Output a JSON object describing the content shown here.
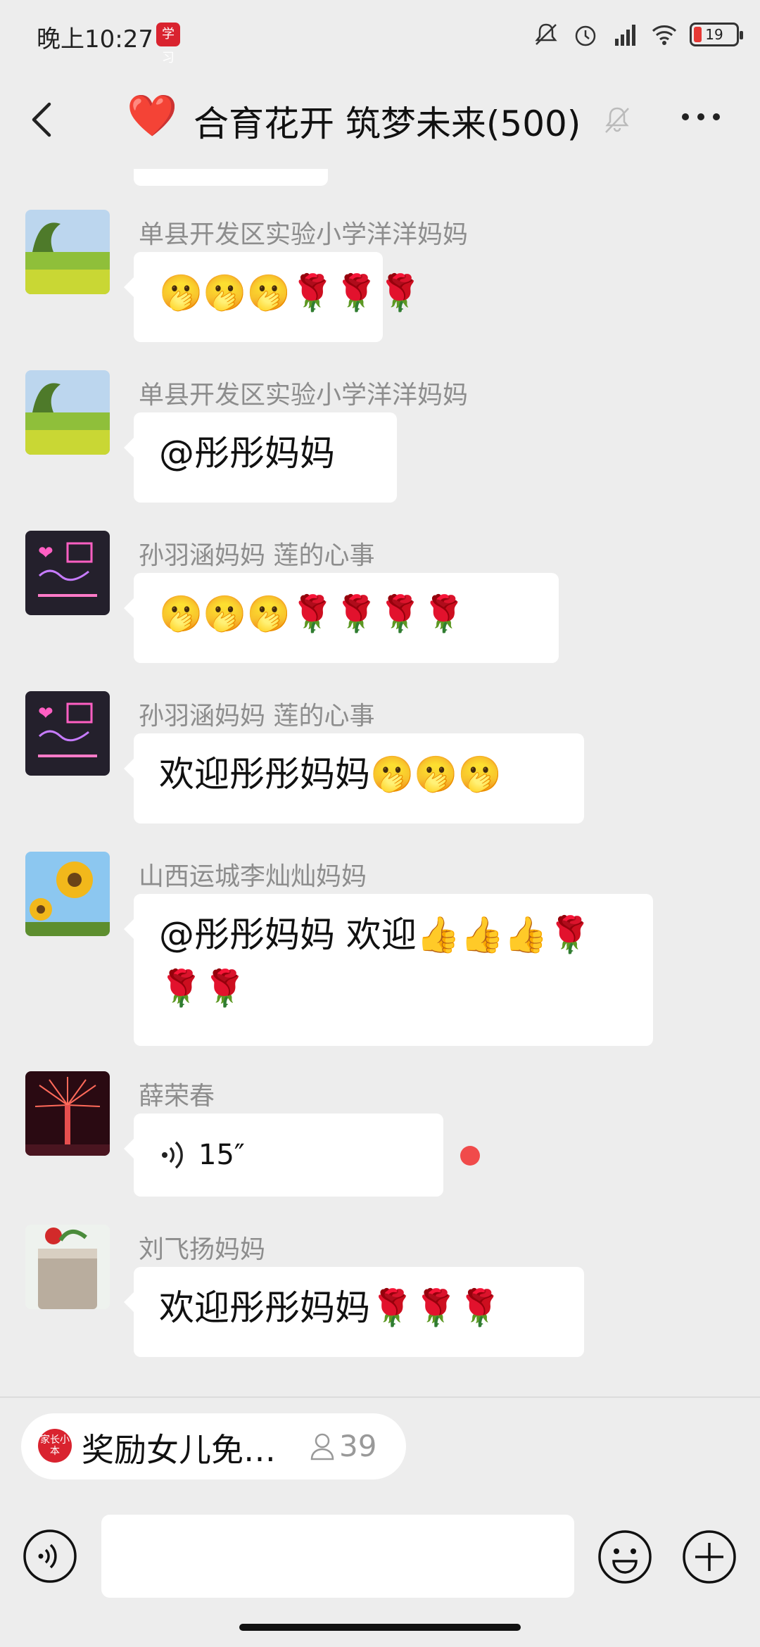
{
  "status_bar": {
    "time": "晚上10:27",
    "app_badge": "学习",
    "battery": "19"
  },
  "header": {
    "title": "合育花开 筑梦未来(500)",
    "heart": "❤️"
  },
  "messages": [
    {
      "sender": "单县开发区实验小学洋洋妈妈",
      "text": "🫢🫢🫢🌹🌹🌹"
    },
    {
      "sender": "单县开发区实验小学洋洋妈妈",
      "text": "@彤彤妈妈"
    },
    {
      "sender": "孙羽涵妈妈  莲的心事",
      "text": "🫢🫢🫢🌹🌹🌹🌹"
    },
    {
      "sender": "孙羽涵妈妈  莲的心事",
      "text": "欢迎彤彤妈妈🫢🫢🫢"
    },
    {
      "sender": "山西运城李灿灿妈妈",
      "text": "@彤彤妈妈  欢迎👍👍👍🌹🌹🌹"
    },
    {
      "sender": "薛荣春",
      "voice_duration": "15″"
    },
    {
      "sender": "刘飞扬妈妈",
      "text": "欢迎彤彤妈妈🌹🌹🌹"
    }
  ],
  "pinned": {
    "logo_text": "家长小本",
    "text": "奖励女儿免…",
    "count": "39"
  },
  "icons": {
    "back": "chevron-left-icon",
    "mute": "bell-off-icon",
    "more": "more-icon",
    "voice": "voice-icon",
    "emoji": "emoji-icon",
    "plus": "plus-icon"
  }
}
